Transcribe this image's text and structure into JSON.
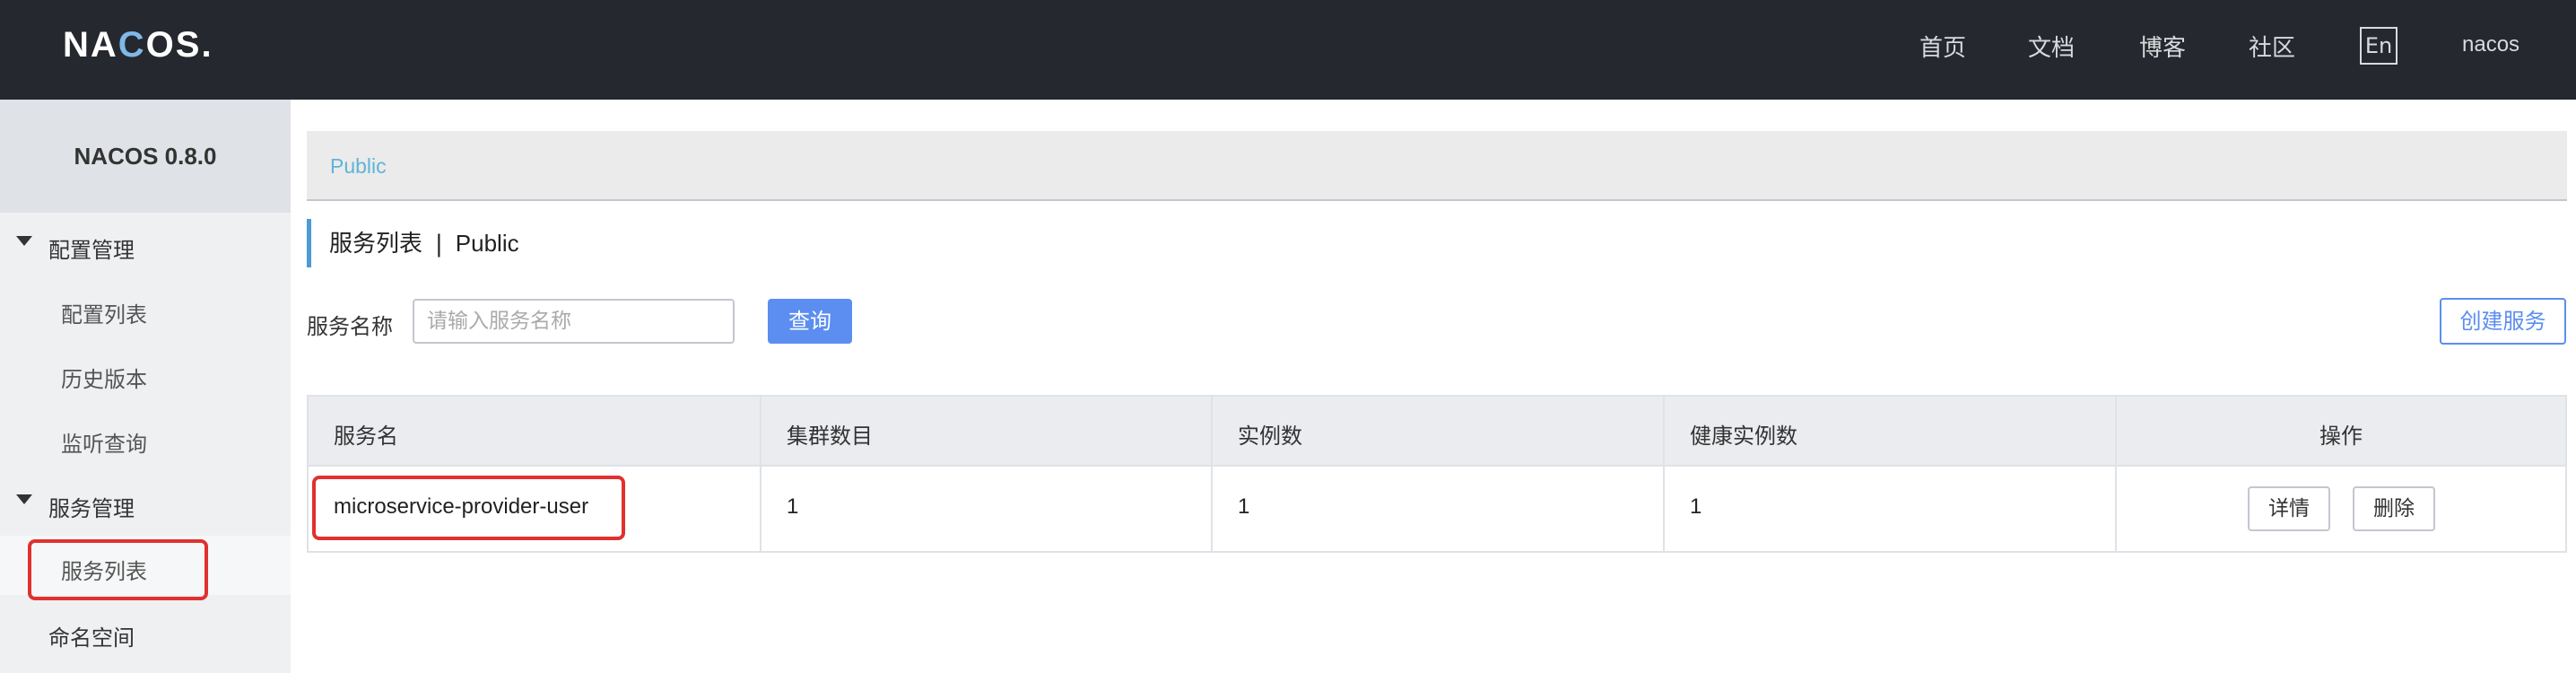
{
  "header": {
    "logo": "NACOS.",
    "nav": [
      "首页",
      "文档",
      "博客",
      "社区"
    ],
    "lang": "En",
    "user": "nacos"
  },
  "sidebar": {
    "version": "NACOS 0.8.0",
    "groups": [
      {
        "label": "配置管理",
        "items": [
          "配置列表",
          "历史版本",
          "监听查询"
        ]
      },
      {
        "label": "服务管理",
        "items": [
          "服务列表"
        ]
      }
    ],
    "namespace": "命名空间"
  },
  "breadcrumb": "Public",
  "title": {
    "main": "服务列表",
    "sep": "|",
    "namespace": "Public"
  },
  "filter": {
    "label": "服务名称",
    "placeholder": "请输入服务名称",
    "query": "查询",
    "create": "创建服务"
  },
  "table": {
    "headers": [
      "服务名",
      "集群数目",
      "实例数",
      "健康实例数",
      "操作"
    ],
    "rows": [
      {
        "name": "microservice-provider-user",
        "clusters": "1",
        "instances": "1",
        "healthy": "1"
      }
    ],
    "actions": {
      "detail": "详情",
      "delete": "删除"
    }
  },
  "colors": {
    "header_bg": "#25282e",
    "accent": "#5b8ef0",
    "highlight": "#e0312e",
    "link": "#5fb4d8"
  }
}
